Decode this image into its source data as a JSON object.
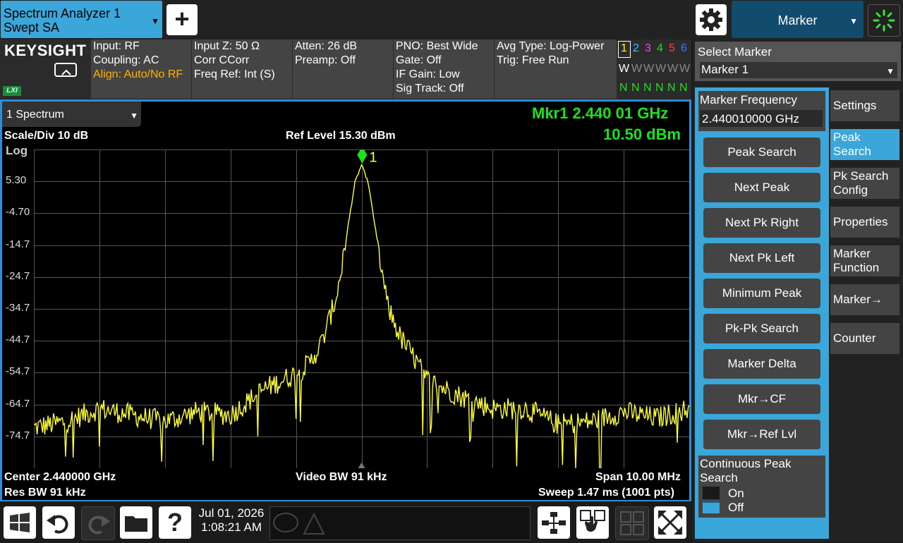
{
  "app_tab": {
    "line1": "Spectrum Analyzer 1",
    "line2": "Swept SA"
  },
  "top": {
    "add_symbol": "+",
    "marker_menu": "Marker"
  },
  "brand": {
    "logo": "KEYSIGHT",
    "lxi": "LXI"
  },
  "settings": {
    "col1": [
      "Input: RF",
      "Coupling: AC",
      "Align: Auto/No RF"
    ],
    "col2": [
      "Input Z: 50 Ω",
      "Corr CCorr",
      "Freq Ref: Int (S)"
    ],
    "col3": [
      "Atten: 26 dB",
      "Preamp: Off"
    ],
    "col4": [
      "PNO: Best Wide",
      "Gate: Off",
      "IF Gain: Low",
      "Sig Track: Off"
    ],
    "col5": [
      "Avg Type: Log-Power",
      "Trig: Free Run"
    ]
  },
  "traces": {
    "numbers": [
      "1",
      "2",
      "3",
      "4",
      "5",
      "6"
    ],
    "number_colors": [
      "#ffff00",
      "#28c8ff",
      "#ff3cff",
      "#1be31b",
      "#ff4040",
      "#3c78ff"
    ],
    "type_row": [
      "W",
      "W",
      "W",
      "W",
      "W",
      "W"
    ],
    "det_row": [
      "N",
      "N",
      "N",
      "N",
      "N",
      "N"
    ]
  },
  "graph": {
    "view": "1 Spectrum",
    "scale": "Scale/Div 10 dB",
    "log": "Log",
    "ref_level": "Ref Level 15.30 dBm",
    "marker_freq": "Mkr1  2.440 01 GHz",
    "marker_amp": "10.50 dBm",
    "marker_num": "1",
    "center": "Center 2.440000 GHz",
    "res_bw": "Res BW 91 kHz",
    "video_bw": "Video BW 91 kHz",
    "span": "Span 10.00 MHz",
    "sweep": "Sweep 1.47 ms (1001 pts)",
    "y_labels": [
      "5.30",
      "-4.70",
      "-14.7",
      "-24.7",
      "-34.7",
      "-44.7",
      "-54.7",
      "-64.7",
      "-74.7"
    ]
  },
  "chart_data": {
    "type": "line",
    "ref_level_dbm": 15.3,
    "scale_db_per_div": 10,
    "center_ghz": 2.44,
    "span_mhz": 10.0,
    "ylim": [
      -84.7,
      15.3
    ],
    "xlim_mhz_offset": [
      -5,
      5
    ],
    "series": [
      {
        "color": "#ffff30",
        "x": [
          -5.0,
          -4.5,
          -4.0,
          -3.5,
          -3.0,
          -2.5,
          -2.0,
          -1.5,
          -1.0,
          -0.8,
          -0.6,
          -0.4,
          -0.3,
          -0.2,
          -0.1,
          0.0,
          0.1,
          0.2,
          0.3,
          0.4,
          0.6,
          0.8,
          1.0,
          1.5,
          2.0,
          2.5,
          3.0,
          3.5,
          4.0,
          4.5,
          5.0
        ],
        "y": [
          -72,
          -70,
          -66,
          -68,
          -70,
          -67,
          -68,
          -60,
          -55,
          -52,
          -45,
          -32,
          -22,
          -8,
          5,
          10.5,
          5,
          -8,
          -22,
          -34,
          -44,
          -50,
          -57,
          -62,
          -66,
          -66,
          -71,
          -70,
          -67,
          -69,
          -66
        ]
      }
    ],
    "marker": {
      "x_mhz_offset": 0.01,
      "y_dbm": 10.5
    }
  },
  "right": {
    "select_marker": "Select Marker",
    "marker_value": "Marker 1",
    "mf_label": "Marker Frequency",
    "mf_value": "2.440010000 GHz",
    "softkeys": [
      "Peak Search",
      "Next Peak",
      "Next Pk Right",
      "Next Pk Left",
      "Minimum Peak",
      "Pk-Pk Search",
      "Marker Delta",
      "Mkr→CF",
      "Mkr→Ref Lvl"
    ],
    "cont_label": "Continuous Peak Search",
    "cont_on": "On",
    "cont_off": "Off",
    "tabs": [
      "Settings",
      "Peak Search",
      "Pk Search Config",
      "Properties",
      "Marker Function",
      "Marker→",
      "Counter"
    ]
  },
  "bottom": {
    "date": "Jul 01, 2026",
    "time": "1:08:21 AM"
  }
}
